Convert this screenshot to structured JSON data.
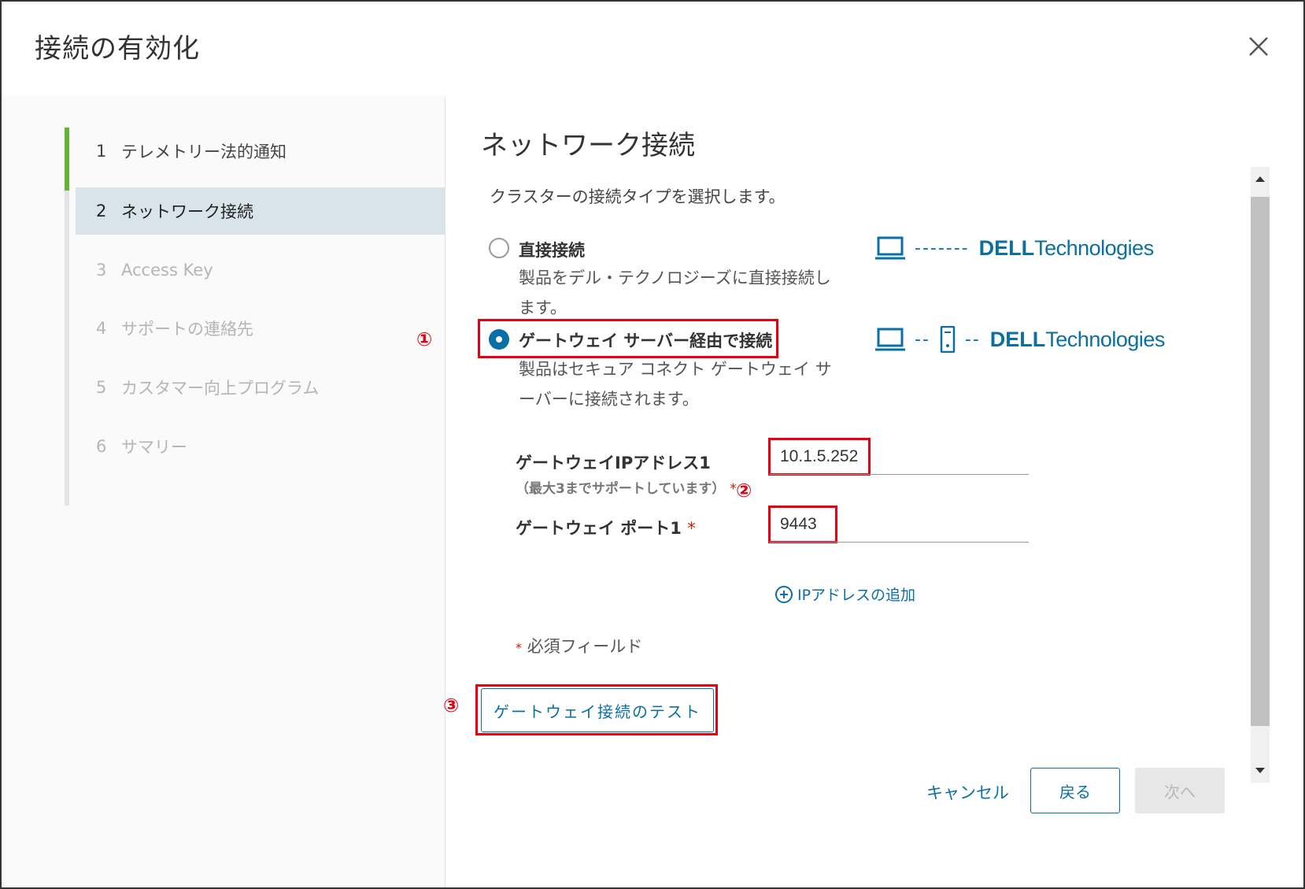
{
  "dialog": {
    "title": "接続の有効化",
    "close_icon": "close-icon"
  },
  "steps": [
    {
      "num": "1",
      "label": "テレメトリー法的通知",
      "state": "done"
    },
    {
      "num": "2",
      "label": "ネットワーク接続",
      "state": "current"
    },
    {
      "num": "3",
      "label": "Access Key",
      "state": "disabled"
    },
    {
      "num": "4",
      "label": "サポートの連絡先",
      "state": "disabled"
    },
    {
      "num": "5",
      "label": "カスタマー向上プログラム",
      "state": "disabled"
    },
    {
      "num": "6",
      "label": "サマリー",
      "state": "disabled"
    }
  ],
  "section": {
    "title": "ネットワーク接続",
    "description": "クラスターの接続タイプを選択します。"
  },
  "options": {
    "direct": {
      "label": "直接接続",
      "description": "製品をデル・テクノロジーズに直接接続します。",
      "diagram_dashes": "-------",
      "selected": false
    },
    "gateway": {
      "label": "ゲートウェイ サーバー経由で接続",
      "description": "製品はセキュア コネクト ゲートウェイ サーバーに接続されます。",
      "diagram_dashes": "--",
      "selected": true
    },
    "brand_dell": "DELL",
    "brand_tech": "Technologies"
  },
  "fields": {
    "ip_label": "ゲートウェイIPアドレス1",
    "ip_sublabel": "（最大3までサポートしています）",
    "ip_value": "10.1.5.252",
    "port_label": "ゲートウェイ ポート1",
    "port_value": "9443",
    "required_mark": "*",
    "add_ip": "IPアドレスの追加",
    "required_note": "必須フィールド"
  },
  "test_button": "ゲートウェイ接続のテスト",
  "annotations": {
    "marker1": "①",
    "marker2": "②",
    "marker3": "③",
    "color": "#e60012"
  },
  "footer": {
    "cancel": "キャンセル",
    "back": "戻る",
    "next": "次へ"
  },
  "colors": {
    "accent": "#0a6fa6",
    "done_step": "#62b536",
    "current_step_bg": "#d8e3ea"
  }
}
